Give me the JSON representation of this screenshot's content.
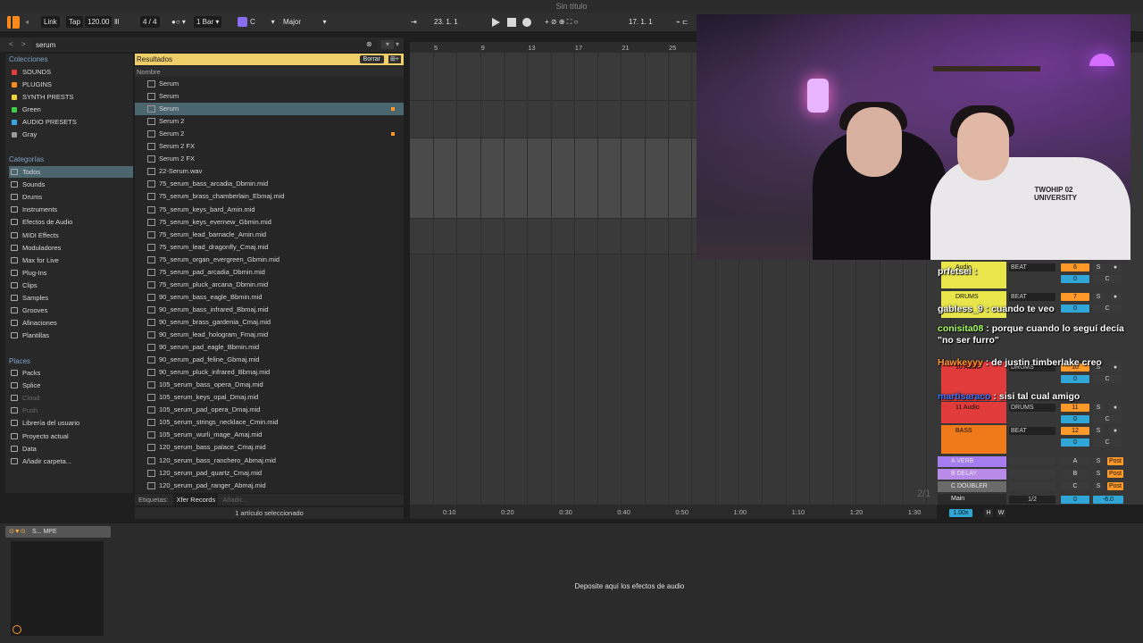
{
  "window": {
    "title": "Sin título"
  },
  "controlbar": {
    "link": "Link",
    "tap": "Tap",
    "tempo": "120.00",
    "sig": "4 / 4",
    "quant": "1 Bar",
    "key": "C",
    "scale": "Major",
    "position": "23.  1.  1",
    "loop_start": "17.  1.  1"
  },
  "browser": {
    "search": "serum",
    "collections_head": "Colecciones",
    "collections": [
      {
        "label": "SOUNDS",
        "color": "#e23b3b"
      },
      {
        "label": "PLUGINS",
        "color": "#ff8a1c"
      },
      {
        "label": "SYNTH PRESTS",
        "color": "#f0d23a"
      },
      {
        "label": "Green",
        "color": "#3fcf4a"
      },
      {
        "label": "AUDIO PRESETS",
        "color": "#3aa6e6"
      },
      {
        "label": "Gray",
        "color": "#9a9a9a"
      }
    ],
    "categories_head": "Categorías",
    "categories": [
      "Todos",
      "Sounds",
      "Drums",
      "Instruments",
      "Efectos de Audio",
      "MIDI Effects",
      "Moduladores",
      "Max for Live",
      "Plug-Ins",
      "Clips",
      "Samples",
      "Grooves",
      "Afinaciones",
      "Plantillas"
    ],
    "places_head": "Places",
    "places": [
      "Packs",
      "Splice",
      "Cloud",
      "Push",
      "Librería del usuario",
      "Proyecto actual",
      "Data",
      "Añadir carpeta..."
    ],
    "results_label": "Resultados",
    "clear_label": "Borrar",
    "name_col": "Nombre",
    "files": [
      "Serum",
      "Serum",
      "Serum",
      "Serum 2",
      "Serum 2",
      "Serum 2 FX",
      "Serum 2 FX",
      "22-Serum.wav",
      "75_serum_bass_arcadia_Dbmin.mid",
      "75_serum_brass_chamberlain_Ebmaj.mid",
      "75_serum_keys_bard_Amin.mid",
      "75_serum_keys_evernew_Gbmin.mid",
      "75_serum_lead_barnacle_Amin.mid",
      "75_serum_lead_dragonfly_Cmaj.mid",
      "75_serum_organ_evergreen_Gbmin.mid",
      "75_serum_pad_arcadia_Dbmin.mid",
      "75_serum_pluck_arcana_Dbmin.mid",
      "90_serum_bass_eagle_Bbmin.mid",
      "90_serum_bass_infrared_Bbmaj.mid",
      "90_serum_brass_gardenia_Cmaj.mid",
      "90_serum_lead_hologram_Fmaj.mid",
      "90_serum_pad_eagle_Bbmin.mid",
      "90_serum_pad_feline_Gbmaj.mid",
      "90_serum_pluck_infrared_Bbmaj.mid",
      "105_serum_bass_opera_Dmaj.mid",
      "105_serum_keys_opal_Dmaj.mid",
      "105_serum_pad_opera_Dmaj.mid",
      "105_serum_strings_necklace_Cmin.mid",
      "105_serum_wurli_mage_Amaj.mid",
      "120_serum_bass_palace_Cmaj.mid",
      "120_serum_bass_ranchero_Abmaj.mid",
      "120_serum_pad_quartz_Cmaj.mid",
      "120_serum_pad_ranger_Abmaj.mid"
    ],
    "tags_label": "Etiquetas:",
    "tag": "Xfer Records",
    "tag_add": "Añadir...",
    "status": "1 artículo seleccionado"
  },
  "arrangement": {
    "bars": [
      "5",
      "9",
      "13",
      "17",
      "21",
      "25"
    ],
    "times": [
      "0:10",
      "0:20",
      "0:30",
      "0:40",
      "0:50",
      "1:00",
      "1:10",
      "1:20",
      "1:30"
    ],
    "page": "2/1"
  },
  "mixer": {
    "tracks": [
      {
        "name": "Audio",
        "color": "#e8e64a"
      },
      {
        "name": "DRUMS",
        "color": "#e8e64a"
      },
      {
        "name": "10 Audio",
        "color": "#e23b3b"
      },
      {
        "name": "11 Audio",
        "color": "#e23b3b"
      },
      {
        "name": "BASS",
        "color": "#f07a1a"
      }
    ],
    "returns": [
      {
        "name": "A VERB",
        "color": "#a67df0",
        "letter": "A"
      },
      {
        "name": "B DELAY",
        "color": "#b98ae8",
        "letter": "B"
      },
      {
        "name": "C DOUBLER",
        "color": "#6a6a6a",
        "letter": "C"
      }
    ],
    "main": "Main",
    "main_ratio": "1/2",
    "main_db": "-6.0",
    "tempo_mult": "1.00x",
    "routing_drums": "DRUMS",
    "routing_beat": "BEAT",
    "nums": [
      "6",
      "7",
      "10",
      "11",
      "12"
    ],
    "post": "Post",
    "h": "H",
    "w": "W"
  },
  "chat": [
    {
      "user": "prfetsel",
      "msg": ":",
      "color": "#ffffff"
    },
    {
      "user": "gabless_9",
      "msg": ": cuando te veo",
      "color": "#ffffff"
    },
    {
      "user": "conisita08",
      "msg": ": porque cuando lo seguí decía \"no ser furro\"",
      "color": "#a6ff5a"
    },
    {
      "user": "Hawkeyyy",
      "msg": ": de justin timberlake creo",
      "color": "#ff9a2a"
    },
    {
      "user": "martisaraco",
      "msg": ": sisi tal cual amigo",
      "color": "#3a78ff"
    }
  ],
  "webcam": {
    "shirt": "TWOHIP 02 UNIVERSITY"
  },
  "device": {
    "head": "S... MPE",
    "drop": "Deposite aquí los efectos de audio"
  }
}
